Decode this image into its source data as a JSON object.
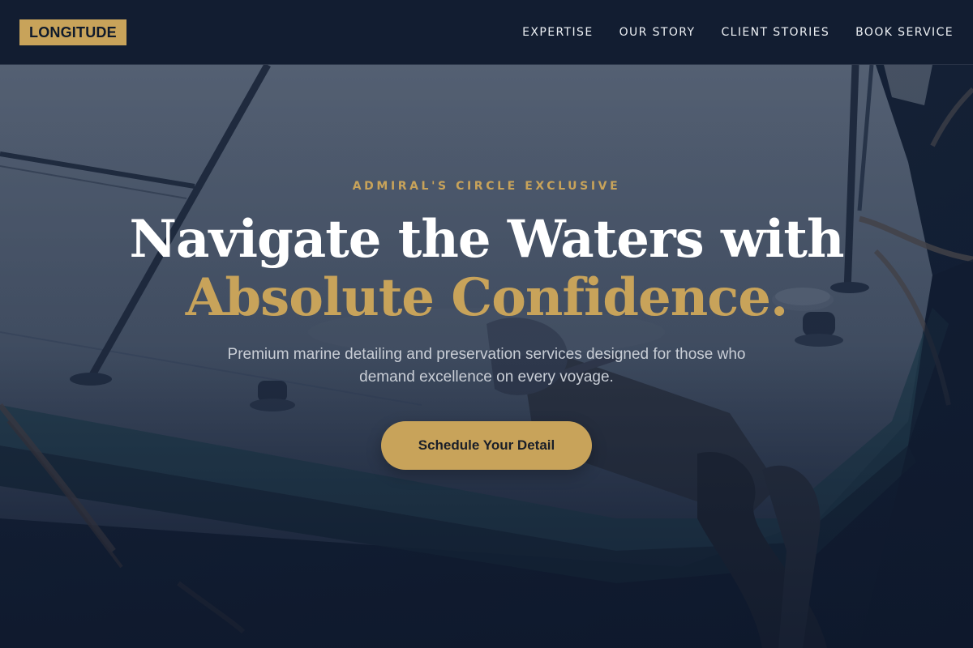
{
  "brand": {
    "logo_text": "LONGITUDE",
    "accent_color": "#c8a35a",
    "nav_background": "#121d31"
  },
  "nav": {
    "items": [
      {
        "label": "EXPERTISE"
      },
      {
        "label": "OUR STORY"
      },
      {
        "label": "CLIENT STORIES"
      },
      {
        "label": "BOOK SERVICE"
      }
    ]
  },
  "hero": {
    "eyebrow": "ADMIRAL'S CIRCLE EXCLUSIVE",
    "headline_line1": "Navigate the Waters with",
    "headline_line2": "Absolute Confidence.",
    "subtext": "Premium marine detailing and preservation services designed for those who demand excellence on every voyage.",
    "cta_label": "Schedule Your Detail",
    "background_image_subject": "boat-deck-photo"
  }
}
